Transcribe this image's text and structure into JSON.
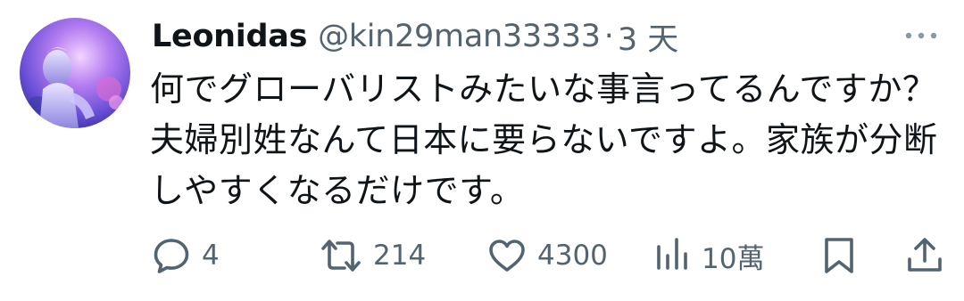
{
  "tweet": {
    "author": {
      "display_name": "Leonidas",
      "handle": "@kin29man33333",
      "avatar_icon": "avatar-image"
    },
    "separator": "·",
    "time": "3 天",
    "more_icon": "more-dots-icon",
    "text": "何でグローバリストみたいな事言ってるんですか？夫婦別姓なんて日本に要らないですよ。家族が分断しやすくなるだけです。",
    "metrics": {
      "replies": "4",
      "retweets": "214",
      "likes": "4300",
      "views": "10萬"
    },
    "colors": {
      "text": "#0f1419",
      "secondary": "#536471",
      "background": "#ffffff"
    }
  }
}
